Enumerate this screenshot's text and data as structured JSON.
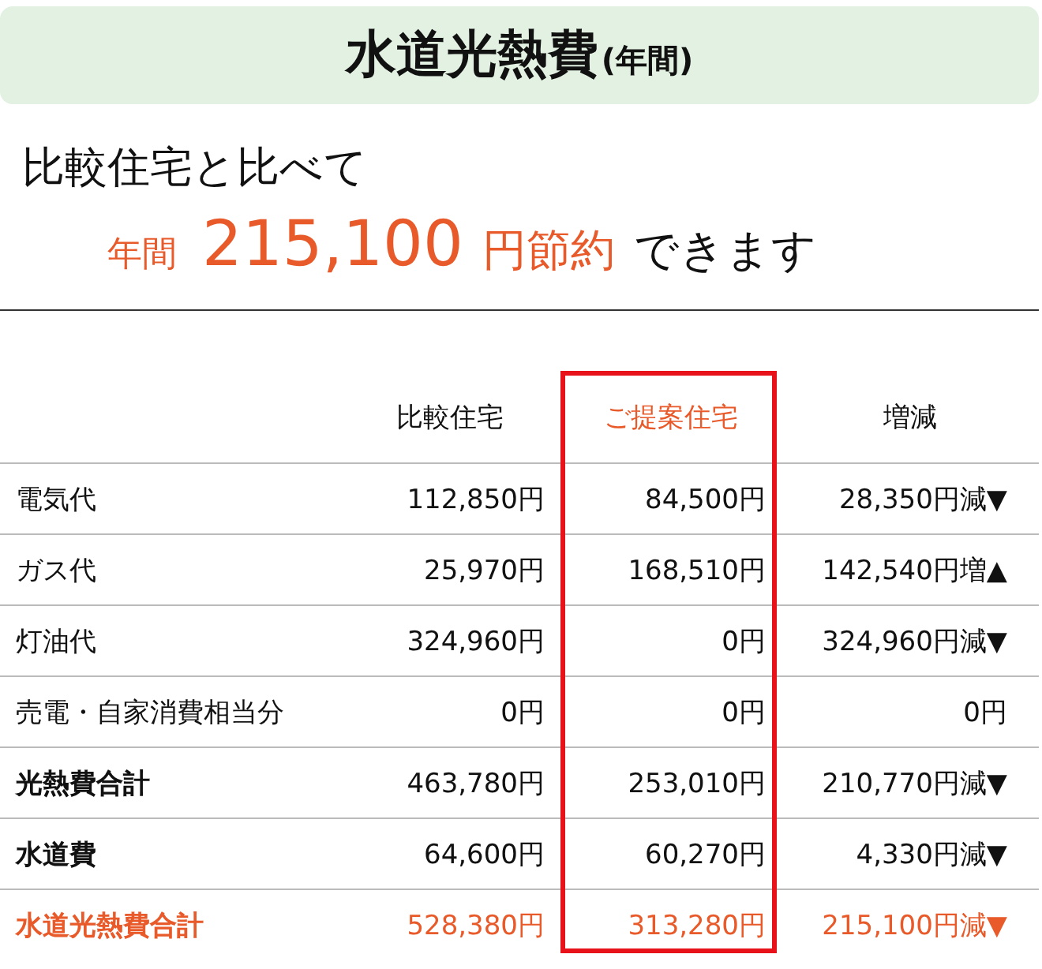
{
  "title": {
    "main": "水道光熱費",
    "sub": "(年間)"
  },
  "lead": "比較住宅と比べて",
  "saving": {
    "prefix": "年間",
    "amount": "215,100",
    "unit": "円節約",
    "suffix": "できます"
  },
  "table": {
    "columns": [
      {
        "label": "比較住宅",
        "selected": false
      },
      {
        "label": "ご提案住宅",
        "selected": true
      },
      {
        "label": "増減",
        "selected": false
      }
    ],
    "rows": [
      {
        "kind": "normal",
        "label": "電気代",
        "cells": [
          "112,850円",
          "84,500円",
          "28,350円減▼"
        ]
      },
      {
        "kind": "normal",
        "label": "ガス代",
        "cells": [
          "25,970円",
          "168,510円",
          "142,540円増▲"
        ]
      },
      {
        "kind": "normal",
        "label": "灯油代",
        "cells": [
          "324,960円",
          "0円",
          "324,960円減▼"
        ]
      },
      {
        "kind": "normal",
        "label": "売電・自家消費相当分",
        "cells": [
          "0円",
          "0円",
          "0円"
        ]
      },
      {
        "kind": "subtotal",
        "label": "光熱費合計",
        "cells": [
          "463,780円",
          "253,010円",
          "210,770円減▼"
        ]
      },
      {
        "kind": "subtotal",
        "label": "水道費",
        "cells": [
          "64,600円",
          "60,270円",
          "4,330円減▼"
        ]
      },
      {
        "kind": "total",
        "label": "水道光熱費合計",
        "cells": [
          "528,380円",
          "313,280円",
          "215,100円減▼"
        ]
      }
    ]
  }
}
